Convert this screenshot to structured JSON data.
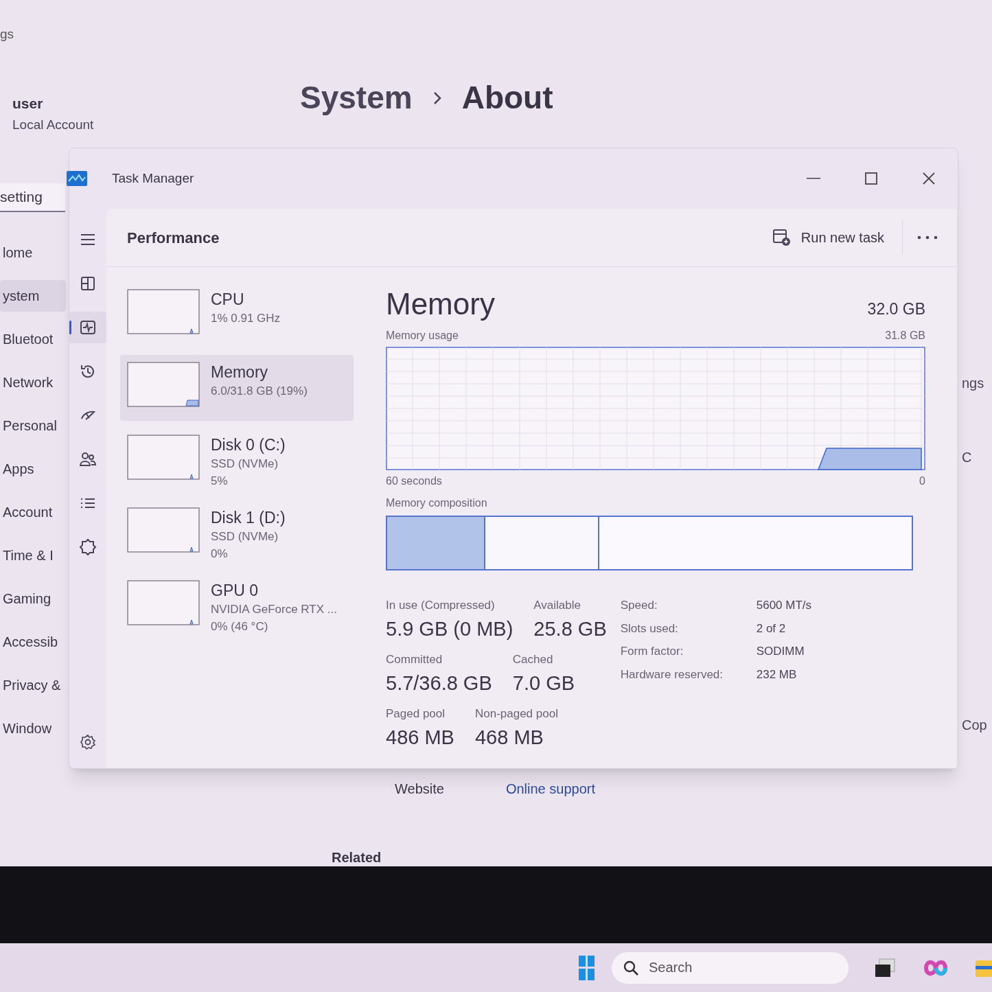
{
  "settings": {
    "header_fragment": "gs",
    "account": {
      "name": "user",
      "type": "Local Account"
    },
    "search": {
      "value": "setting"
    },
    "title": {
      "parent": "System",
      "page": "About"
    },
    "nav": [
      {
        "label": "lome",
        "selected": false
      },
      {
        "label": "ystem",
        "selected": true
      },
      {
        "label": "Bluetoot",
        "selected": false
      },
      {
        "label": "Network",
        "selected": false
      },
      {
        "label": "Personal",
        "selected": false
      },
      {
        "label": "Apps",
        "selected": false
      },
      {
        "label": "Account",
        "selected": false
      },
      {
        "label": "Time & I",
        "selected": false
      },
      {
        "label": "Gaming",
        "selected": false
      },
      {
        "label": "Accessib",
        "selected": false
      },
      {
        "label": "Privacy &",
        "selected": false
      },
      {
        "label": "Window",
        "selected": false
      }
    ],
    "support": {
      "label": "Website",
      "link": "Online support"
    },
    "related": "Related",
    "right_fragments": [
      "ngs",
      "C",
      "Cop"
    ]
  },
  "task_manager": {
    "title": "Task Manager",
    "rail": [
      {
        "kind": "menu",
        "selected": false
      },
      {
        "kind": "processes",
        "selected": false
      },
      {
        "kind": "performance",
        "selected": true
      },
      {
        "kind": "history",
        "selected": false
      },
      {
        "kind": "startup",
        "selected": false
      },
      {
        "kind": "users",
        "selected": false
      },
      {
        "kind": "details",
        "selected": false
      },
      {
        "kind": "services",
        "selected": false
      }
    ],
    "page_title": "Performance",
    "run_new_task": "Run new task",
    "devices": [
      {
        "name": "CPU",
        "details": [
          "1% 0.91 GHz"
        ],
        "selected": false
      },
      {
        "name": "Memory",
        "details": [
          "6.0/31.8 GB (19%)"
        ],
        "selected": true
      },
      {
        "name": "Disk 0 (C:)",
        "details": [
          "SSD (NVMe)",
          "5%"
        ],
        "selected": false
      },
      {
        "name": "Disk 1 (D:)",
        "details": [
          "SSD (NVMe)",
          "0%"
        ],
        "selected": false
      },
      {
        "name": "GPU 0",
        "details": [
          "NVIDIA GeForce RTX ...",
          "0% (46 °C)"
        ],
        "selected": false
      }
    ],
    "detail": {
      "title": "Memory",
      "total": "32.0 GB",
      "usage_label": "Memory usage",
      "usage_max": "31.8 GB",
      "time_span": "60 seconds",
      "axis_min": "0",
      "composition_label": "Memory composition",
      "composition": [
        {
          "kind": "in_use",
          "level": 0.187
        },
        {
          "kind": "standby",
          "level": 0.218
        },
        {
          "kind": "free",
          "level": 0.595
        }
      ],
      "stats": [
        [
          {
            "label": "In use (Compressed)",
            "value": "5.9 GB (0 MB)"
          },
          {
            "label": "Available",
            "value": "25.8 GB"
          }
        ],
        [
          {
            "label": "Committed",
            "value": "5.7/36.8 GB"
          },
          {
            "label": "Cached",
            "value": "7.0 GB"
          }
        ],
        [
          {
            "label": "Paged pool",
            "value": "486 MB"
          },
          {
            "label": "Non-paged pool",
            "value": "468 MB"
          }
        ]
      ],
      "specs": [
        {
          "label": "Speed:",
          "value": "5600 MT/s"
        },
        {
          "label": "Slots used:",
          "value": "2 of 2"
        },
        {
          "label": "Form factor:",
          "value": "SODIMM"
        },
        {
          "label": "Hardware reserved:",
          "value": "232 MB"
        }
      ]
    }
  },
  "taskbar": {
    "search": {
      "placeholder": "Search"
    }
  }
}
